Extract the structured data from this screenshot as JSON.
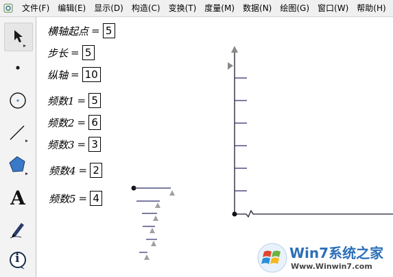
{
  "menu": {
    "items": [
      {
        "label": "文件(F)"
      },
      {
        "label": "编辑(E)"
      },
      {
        "label": "显示(D)"
      },
      {
        "label": "构造(C)"
      },
      {
        "label": "变换(T)"
      },
      {
        "label": "度量(M)"
      },
      {
        "label": "数据(N)"
      },
      {
        "label": "绘图(G)"
      },
      {
        "label": "窗口(W)"
      },
      {
        "label": "帮助(H)"
      }
    ]
  },
  "toolbox": {
    "text_tool_glyph": "A",
    "info_tool_glyph": "i",
    "icons": [
      "arrow-select-icon",
      "point-icon",
      "compass-icon",
      "line-icon",
      "polygon-icon",
      "text-icon",
      "marker-icon",
      "info-icon"
    ]
  },
  "params": {
    "x_start": {
      "label": "横轴起点",
      "eq": "=",
      "value": "5"
    },
    "step": {
      "label": "步长",
      "eq": "=",
      "value": "5"
    },
    "y_axis": {
      "label": "纵轴",
      "eq": "=",
      "value": "10"
    },
    "freq1": {
      "label": "频数1",
      "eq": "=",
      "value": "5"
    },
    "freq2": {
      "label": "频数2",
      "eq": "=",
      "value": "6"
    },
    "freq3": {
      "label": "频数3",
      "eq": "=",
      "value": "3"
    },
    "freq4": {
      "label": "频数4",
      "eq": "=",
      "value": "2"
    },
    "freq5": {
      "label": "频数5",
      "eq": "=",
      "value": "4"
    }
  },
  "watermark": {
    "main": "Win7系统之家",
    "url": "Www.Winwin7.com"
  },
  "colors": {
    "axis": "#1a1a2e",
    "tick": "#2b2b6b",
    "slider_triangle": "#a0a0a0",
    "watermark_blue": "#2b6fb8"
  }
}
